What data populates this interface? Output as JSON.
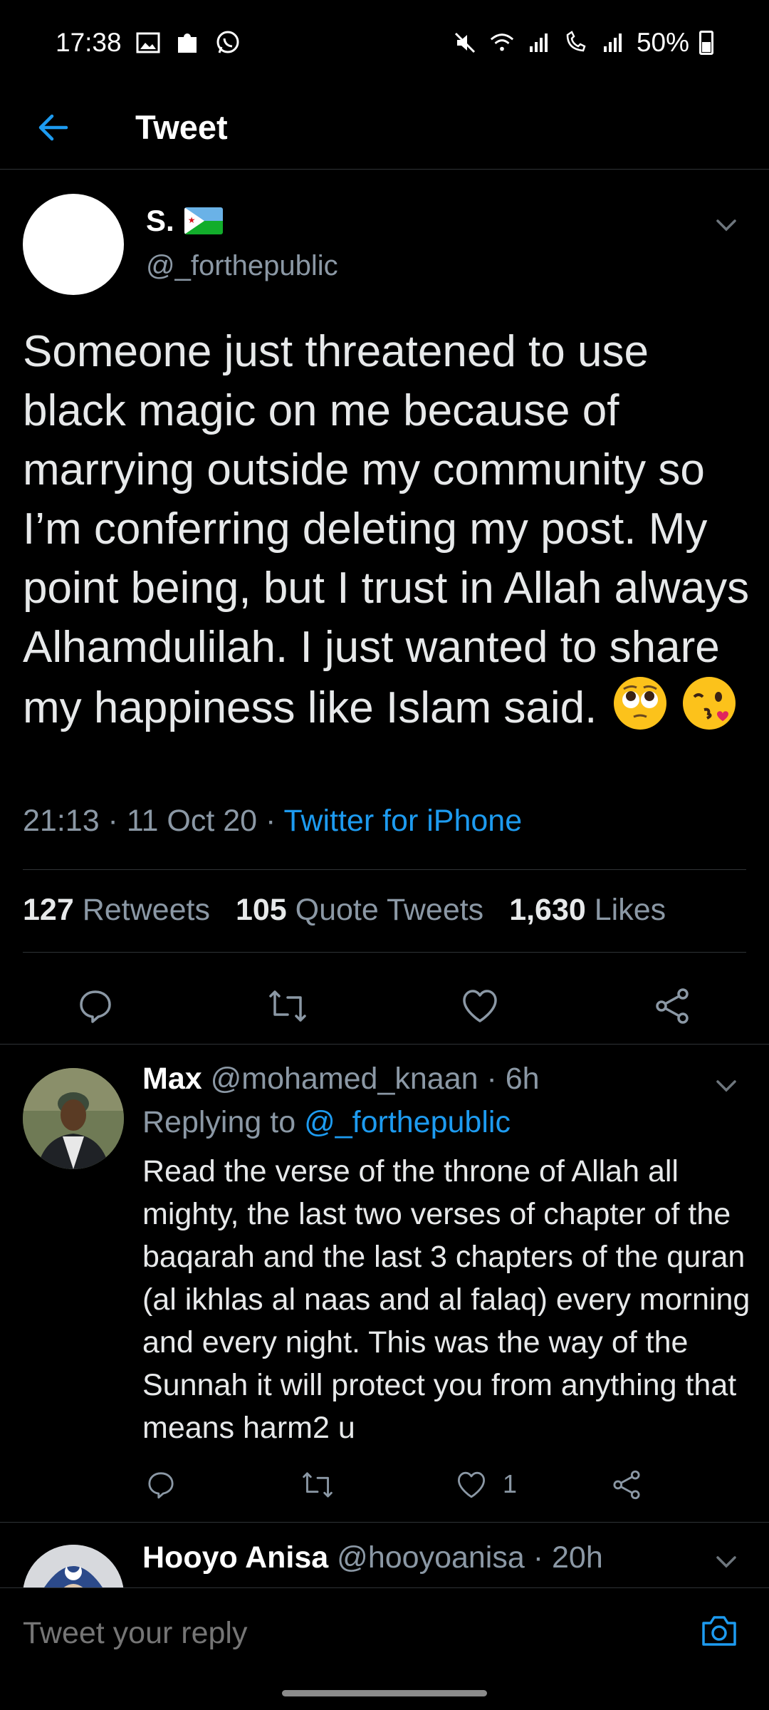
{
  "status_bar": {
    "time": "17:38",
    "battery": "50%",
    "icons": [
      "gallery-icon",
      "puzzle-icon",
      "whatsapp-icon",
      "mute-icon",
      "wifi-icon",
      "signal-icon",
      "wifi-call-icon",
      "signal-2-icon",
      "battery-icon"
    ]
  },
  "header": {
    "title": "Tweet",
    "back_icon": "arrow-left-icon"
  },
  "tweet": {
    "author_name": "S.",
    "author_handle": "@_forthepublic",
    "text": "Someone just threatened to use black magic on me because of marrying outside my community so I’m conferring deleting my post. My point being, but I trust in Allah always Alhamdulilah. I just wanted to share my happiness like Islam said.",
    "time": "21:13",
    "date": "11 Oct 20",
    "source": "Twitter for iPhone",
    "separator": " · ",
    "stats": {
      "retweets": "127",
      "retweets_label": "Retweets",
      "quotes": "105",
      "quotes_label": "Quote Tweets",
      "likes": "1,630",
      "likes_label": "Likes"
    },
    "emojis": [
      "pleading-face-emoji",
      "face-blowing-kiss-emoji"
    ]
  },
  "replies": [
    {
      "name": "Max",
      "handle": "@mohamed_knaan",
      "time": "6h",
      "replying_to_label": "Replying to ",
      "replying_to": "@_forthepublic",
      "text": "Read the verse of the throne of Allah all mighty, the last two verses of chapter of the baqarah and the last 3 chapters of the quran (al ikhlas al naas and al falaq) every morning and every night. This was the way of the Sunnah it will protect you from anything that means harm2 u",
      "likes": "1"
    },
    {
      "name": "Hooyo Anisa",
      "handle": "@hooyoanisa",
      "time": "20h"
    }
  ],
  "composer": {
    "placeholder": "Tweet your reply"
  },
  "colors": {
    "background": "#000000",
    "accent": "#1d9bf0",
    "muted": "#8b98a5",
    "divider": "#2f3336"
  }
}
